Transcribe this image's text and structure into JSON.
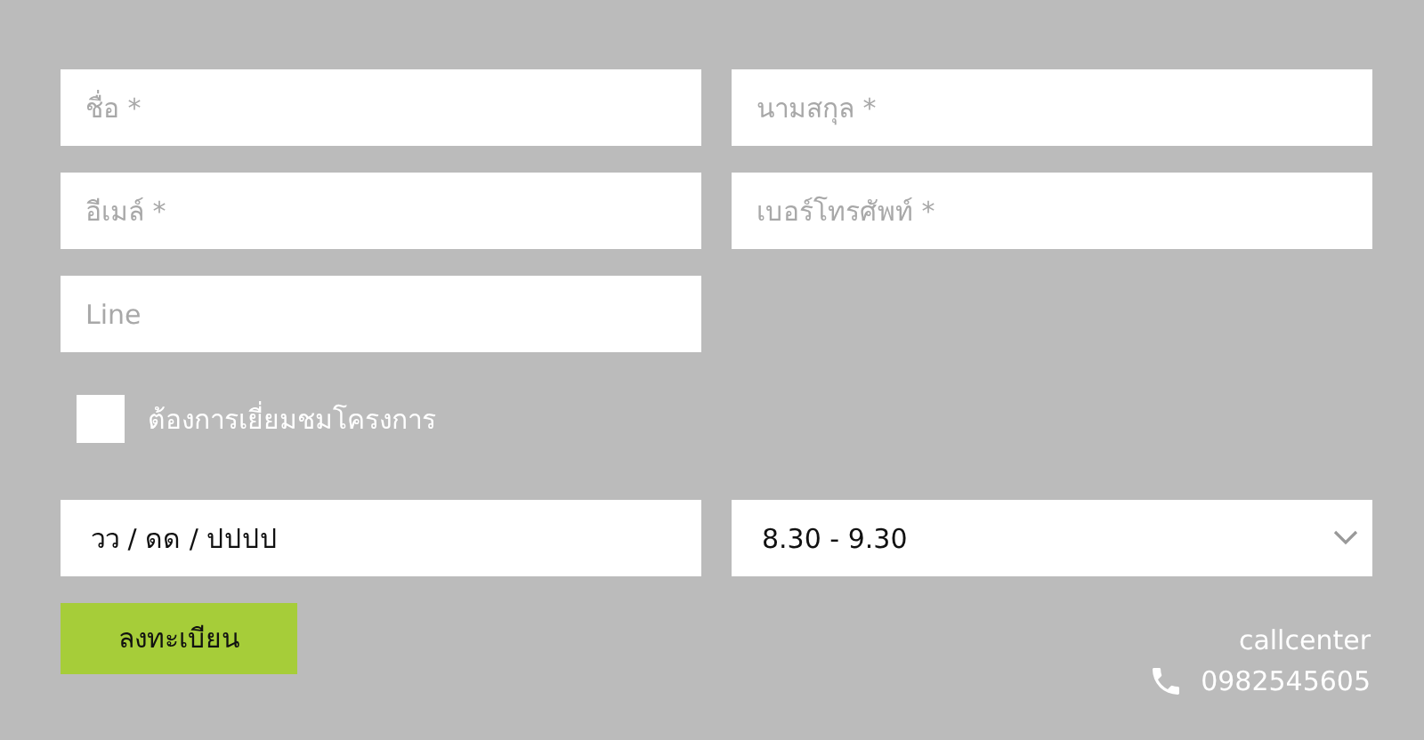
{
  "fields": [
    {
      "placeholder": "ชื่อ *"
    },
    {
      "placeholder": "นามสกุล *"
    },
    {
      "placeholder": "อีเมล์ *"
    },
    {
      "placeholder": "เบอร์โทรศัพท์ *"
    },
    {
      "placeholder": "Line"
    }
  ],
  "visit": {
    "label": "ต้องการเยี่ยมชมโครงการ",
    "checked": false
  },
  "date": {
    "value": "วว / ดด / ปปปป"
  },
  "time": {
    "value": "8.30 - 9.30"
  },
  "submit": "ลงทะเบียน",
  "contact": {
    "label": "callcenter",
    "phone": "0982545605"
  }
}
